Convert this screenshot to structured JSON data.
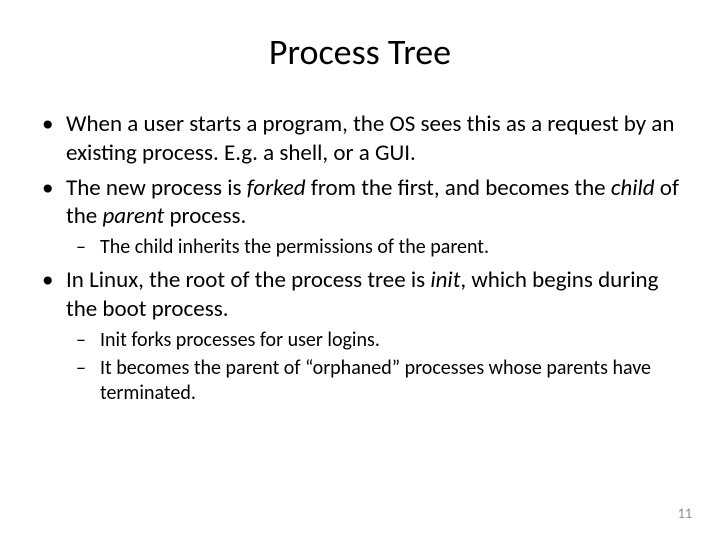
{
  "title": "Process Tree",
  "bullets": {
    "b1a": "When a user starts a program, the OS sees this as a request by an existing process. E.g. a shell, or a GUI.",
    "b2a": "The new process is ",
    "b2b": "forked",
    "b2c": " from the first, and becomes the ",
    "b2d": "child",
    "b2e": " of the ",
    "b2f": "parent",
    "b2g": " process.",
    "b2_1": "The child inherits the permissions of the parent.",
    "b3a": "In Linux, the root of the process tree is ",
    "b3b": "init",
    "b3c": ", which begins during the boot process.",
    "b3_1": "Init forks processes for user logins.",
    "b3_2": "It becomes the parent of “orphaned” processes whose parents have terminated."
  },
  "page_number": "11"
}
